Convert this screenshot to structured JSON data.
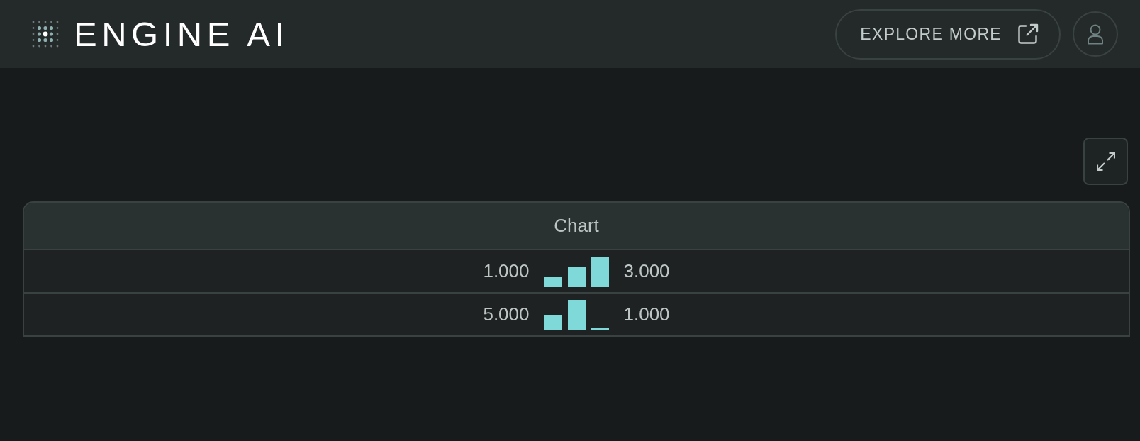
{
  "header": {
    "logo_text": "ENGINE AI",
    "explore_link": {
      "label": "EXPLORE MORE"
    }
  },
  "table": {
    "columns": [
      {
        "label": "Chart"
      }
    ],
    "rows": [
      {
        "cells": [
          {
            "first_value": "1.000",
            "last_value": "3.000"
          }
        ]
      },
      {
        "cells": [
          {
            "first_value": "5.000",
            "last_value": "1.000"
          }
        ]
      }
    ]
  }
}
